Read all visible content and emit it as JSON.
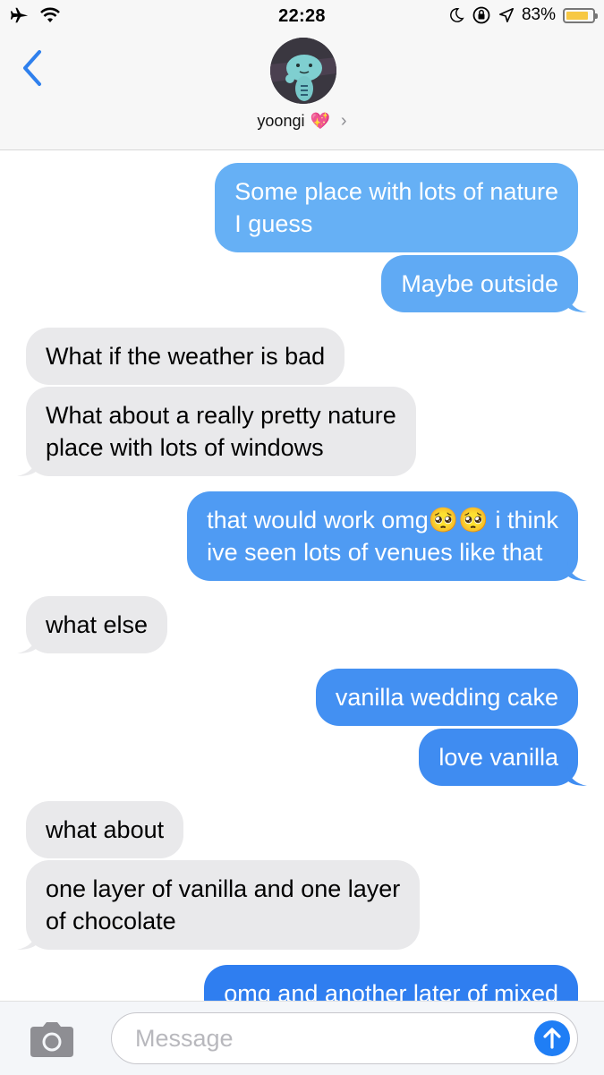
{
  "status_bar": {
    "time": "22:28",
    "battery_percent": "83%",
    "battery_level": 0.83,
    "icons": [
      "airplane-icon",
      "wifi-icon",
      "moon-icon",
      "orientation-lock-icon",
      "location-arrow-icon",
      "battery-icon"
    ]
  },
  "header": {
    "contact_name": "yoongi",
    "contact_emoji": "💖",
    "contact_chevron": "›",
    "back_icon": "chevron-left-icon"
  },
  "messages": [
    {
      "dir": "out",
      "lines": [
        "Some place with lots of nature",
        "I guess"
      ]
    },
    {
      "dir": "out",
      "lines": [
        "Maybe outside"
      ]
    },
    {
      "dir": "in",
      "lines": [
        "What if the weather is bad"
      ]
    },
    {
      "dir": "in",
      "lines": [
        "What about a really pretty nature",
        "place with lots of windows"
      ]
    },
    {
      "dir": "out",
      "lines": [
        "that would work omg🥺🥺 i think",
        "ive seen lots of venues like that"
      ]
    },
    {
      "dir": "in",
      "lines": [
        "what else"
      ]
    },
    {
      "dir": "out",
      "lines": [
        "vanilla wedding cake"
      ]
    },
    {
      "dir": "out",
      "lines": [
        "love vanilla"
      ]
    },
    {
      "dir": "in",
      "lines": [
        "what about"
      ]
    },
    {
      "dir": "in",
      "lines": [
        "one layer of vanilla and one layer",
        "of chocolate"
      ]
    },
    {
      "dir": "out",
      "lines": [
        "omg and another later of mixed"
      ]
    }
  ],
  "input": {
    "placeholder": "Message",
    "camera_icon": "camera-icon",
    "send_icon": "arrow-up-icon"
  },
  "colors": {
    "outgoing_top": "#67b1f5",
    "outgoing_bottom": "#2f7ef0",
    "incoming": "#e9e9eb",
    "accent": "#1f7ef5"
  }
}
